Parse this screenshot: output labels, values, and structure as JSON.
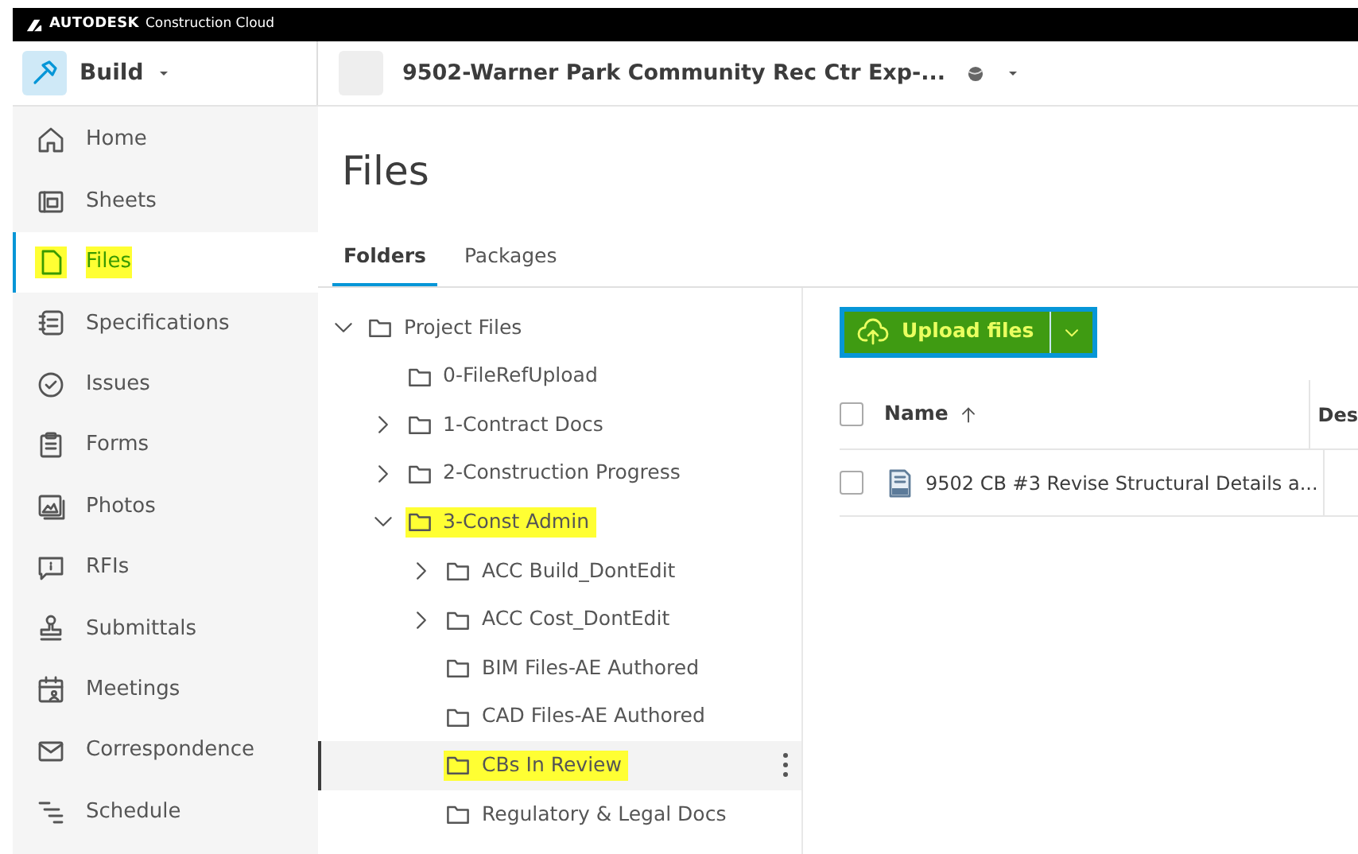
{
  "header": {
    "brand": "AUTODESK",
    "brand_sub": "Construction Cloud"
  },
  "app_switcher": {
    "label": "Build"
  },
  "project": {
    "name": "9502-Warner Park Community Rec Ctr Exp-..."
  },
  "sidebar": {
    "items": [
      {
        "label": "Home",
        "kind": "home",
        "selected": false,
        "highlighted": false
      },
      {
        "label": "Sheets",
        "kind": "sheets",
        "selected": false,
        "highlighted": false
      },
      {
        "label": "Files",
        "kind": "file",
        "selected": true,
        "highlighted": true
      },
      {
        "label": "Specifications",
        "kind": "specs",
        "selected": false,
        "highlighted": false
      },
      {
        "label": "Issues",
        "kind": "issues",
        "selected": false,
        "highlighted": false
      },
      {
        "label": "Forms",
        "kind": "forms",
        "selected": false,
        "highlighted": false
      },
      {
        "label": "Photos",
        "kind": "photos",
        "selected": false,
        "highlighted": false
      },
      {
        "label": "RFIs",
        "kind": "rfis",
        "selected": false,
        "highlighted": false
      },
      {
        "label": "Submittals",
        "kind": "stamp",
        "selected": false,
        "highlighted": false
      },
      {
        "label": "Meetings",
        "kind": "meetings",
        "selected": false,
        "highlighted": false
      },
      {
        "label": "Correspondence",
        "kind": "mail",
        "selected": false,
        "highlighted": false
      },
      {
        "label": "Schedule",
        "kind": "schedule",
        "selected": false,
        "highlighted": false
      }
    ]
  },
  "page_title": "Files",
  "tabs": [
    {
      "label": "Folders",
      "selected": true
    },
    {
      "label": "Packages",
      "selected": false
    }
  ],
  "tree": [
    {
      "label": "Project Files",
      "expanded": true,
      "selected": false,
      "highlighted": false,
      "children": [
        {
          "label": "0-FileRefUpload",
          "selected": false,
          "highlighted": false
        },
        {
          "label": "1-Contract Docs",
          "expanded": false,
          "selected": false,
          "highlighted": false
        },
        {
          "label": "2-Construction Progress",
          "expanded": false,
          "selected": false,
          "highlighted": false
        },
        {
          "label": "3-Const Admin",
          "expanded": true,
          "selected": false,
          "highlighted": true,
          "children": [
            {
              "label": "ACC Build_DontEdit",
              "expanded": false,
              "selected": false,
              "highlighted": false
            },
            {
              "label": "ACC Cost_DontEdit",
              "expanded": false,
              "selected": false,
              "highlighted": false
            },
            {
              "label": "BIM Files-AE Authored",
              "selected": false,
              "highlighted": false
            },
            {
              "label": "CAD Files-AE Authored",
              "selected": false,
              "highlighted": false
            },
            {
              "label": "CBs In Review",
              "selected": true,
              "highlighted": true
            },
            {
              "label": "Regulatory & Legal Docs",
              "selected": false,
              "highlighted": false
            }
          ]
        }
      ]
    }
  ],
  "upload_button": {
    "label": "Upload files",
    "highlighted": true
  },
  "table": {
    "all_checked": false,
    "columns": [
      {
        "label": "Name",
        "sorted": true
      },
      {
        "label": "Des",
        "sorted": false
      }
    ],
    "rows": [
      {
        "name": "9502 CB #3 Revise Structural Details a...",
        "checked": false
      }
    ]
  }
}
